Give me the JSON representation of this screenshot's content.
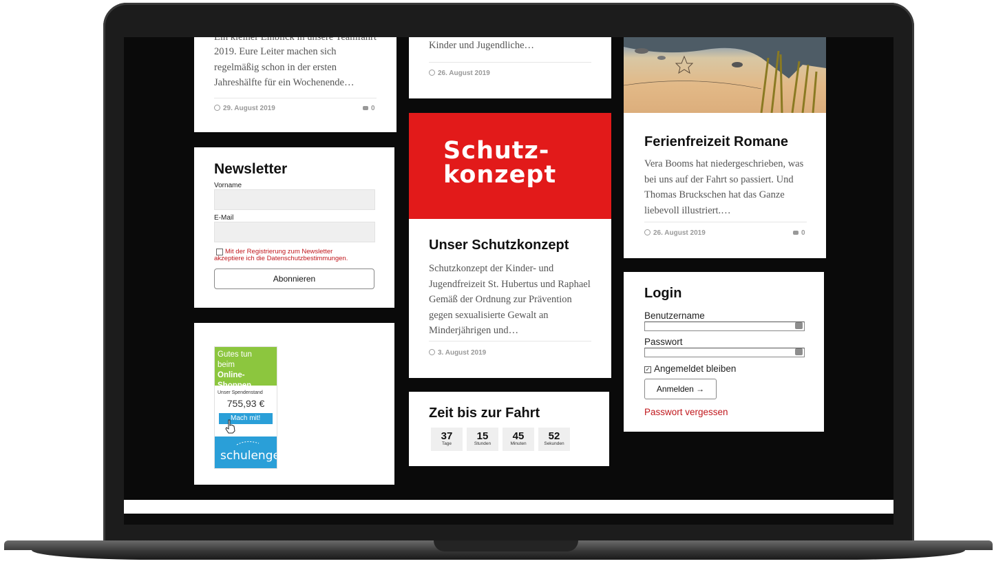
{
  "post_left": {
    "excerpt_cut": "Ein kleiner Einblick in unsere Teamfahrt",
    "excerpt": "2019. Eure Leiter machen sich regelmäßig schon in der ersten Jahreshälfte für ein Wochenende…",
    "date": "29. August 2019",
    "comments": "0"
  },
  "post_mid_top": {
    "excerpt": "Kinder und Jugendliche…",
    "date": "26. August 2019"
  },
  "newsletter": {
    "title": "Newsletter",
    "first_name_label": "Vorname",
    "email_label": "E-Mail",
    "consent_line1": "Mit der Registrierung zum Newsletter",
    "consent_line2": "akzeptiere ich die Datenschutzbestimmungen.",
    "subscribe_button": "Abonnieren"
  },
  "schutzkonzept": {
    "image_text_1": "Schutz-",
    "image_text_2": "konzept",
    "title": "Unser Schutzkonzept",
    "excerpt": "Schutzkonzept der Kinder- und Jugendfreizeit St. Hubertus und Raphael Gemäß der Ordnung zur Prävention gegen sexualisierte Gewalt an Minderjährigen und…",
    "date": "3. August 2019",
    "brand_red": "#e21a1a"
  },
  "ferienfreizeit": {
    "title": "Ferienfreizeit Romane",
    "excerpt": "Vera Booms hat niedergeschrieben, was bei uns auf der Fahrt so passiert. Und Thomas Bruckschen hat das Ganze liebevoll illustriert.…",
    "date": "26. August 2019",
    "comments": "0"
  },
  "schulengel": {
    "line1": "Gutes tun",
    "line2": "beim",
    "line2_bold": "Online-",
    "line3": "Shoppen",
    "stand_label": "Unser Spendenstand",
    "amount": "755,93 €",
    "cta": "Mach mit!",
    "logo": "schulengel"
  },
  "countdown": {
    "title": "Zeit bis zur Fahrt",
    "units": [
      {
        "value": "37",
        "label": "Tage"
      },
      {
        "value": "15",
        "label": "Stunden"
      },
      {
        "value": "45",
        "label": "Minuten"
      },
      {
        "value": "52",
        "label": "Sekunden"
      }
    ]
  },
  "login": {
    "title": "Login",
    "username_label": "Benutzername",
    "password_label": "Passwort",
    "remember_label": "Angemeldet bleiben",
    "submit_label": "Anmelden →",
    "forgot_label": "Passwort vergessen",
    "link_red": "#c0171c"
  }
}
